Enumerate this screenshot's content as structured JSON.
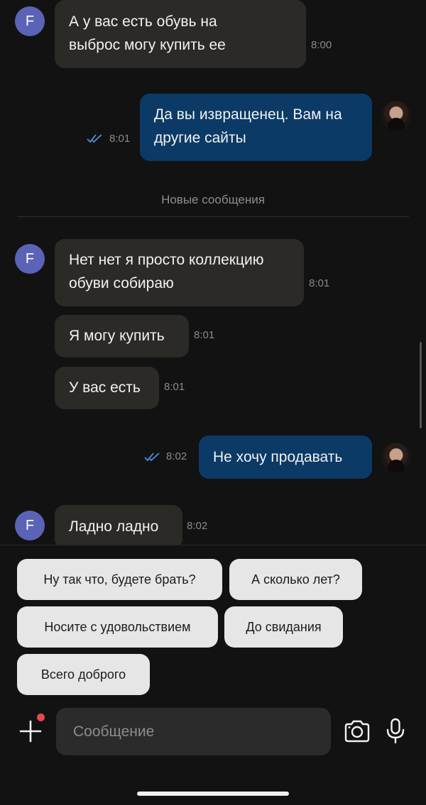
{
  "contact": {
    "initial": "F",
    "avatar_color": "#5b63b7"
  },
  "colors": {
    "background": "#121212",
    "incoming_bubble": "#2b2a27",
    "outgoing_bubble": "#0b3a66",
    "read_ticks": "#4a90e2",
    "chip": "#e6e6e6",
    "badge": "#e5484d"
  },
  "messages": [
    {
      "direction": "in",
      "text": "А у вас есть обувь на выброс могу купить ее",
      "time": "8:00"
    },
    {
      "direction": "out",
      "text": "Да вы извращенец. Вам на другие сайты",
      "time": "8:01",
      "status": "read"
    },
    {
      "direction": "in",
      "text": "Нет нет я просто коллекцию обуви собираю",
      "time": "8:01"
    },
    {
      "direction": "in",
      "text": "Я могу купить",
      "time": "8:01"
    },
    {
      "direction": "in",
      "text": "У вас есть",
      "time": "8:01"
    },
    {
      "direction": "out",
      "text": "Не хочу продавать",
      "time": "8:02",
      "status": "read"
    },
    {
      "direction": "in",
      "text": "Ладно ладно",
      "time": "8:02"
    }
  ],
  "divider": {
    "label": "Новые сообщения"
  },
  "quick_replies": [
    "Ну так что, будете брать?",
    "А сколько лет?",
    "Носите с удовольствием",
    "До свидания",
    "Всего доброго"
  ],
  "composer": {
    "placeholder": "Сообщение",
    "icons": {
      "attach": "plus-icon",
      "camera": "camera-icon",
      "voice": "microphone-icon"
    }
  }
}
